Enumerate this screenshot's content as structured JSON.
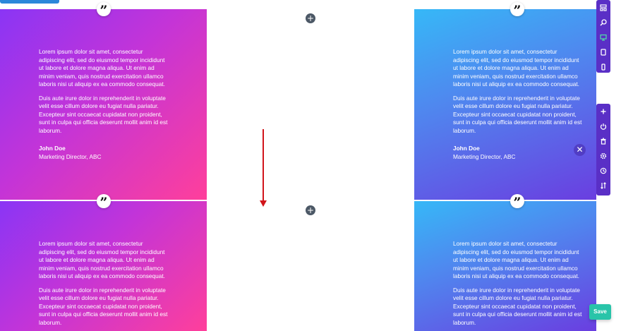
{
  "testimonial": {
    "paragraph1": "Lorem ipsum dolor sit amet, consectetur adipiscing elit, sed do eiusmod tempor incididunt ut labore et dolore magna aliqua. Ut enim ad minim veniam, quis nostrud exercitation ullamco laboris nisi ut aliquip ex ea commodo consequat.",
    "paragraph2": "Duis aute irure dolor in reprehenderit in voluptate velit esse cillum dolore eu fugiat nulla pariatur. Excepteur sint occaecat cupidatat non proident, sunt in culpa qui officia deserunt mollit anim id est laborum.",
    "author": "John Doe",
    "role": "Marketing Director, ABC"
  },
  "ui": {
    "quote_glyph": "”",
    "add_glyph": "+",
    "close_glyph": "✕",
    "save_label": "Save"
  },
  "colors": {
    "pink_gradient": [
      "#8a35f5",
      "#c334d8",
      "#ff3f9b"
    ],
    "blue_gradient": [
      "#36b8f7",
      "#4f88ef",
      "#6a3ee0"
    ],
    "arrow": "#d1141a",
    "save": "#29c4a9",
    "toolbar": "#5a2fc6"
  },
  "toolbar_top": [
    "wireframe-icon",
    "zoom-icon",
    "desktop-icon",
    "tablet-icon",
    "phone-icon"
  ],
  "toolbar_bottom": [
    "add-icon",
    "power-icon",
    "trash-icon",
    "settings-icon",
    "history-icon",
    "sort-icon"
  ]
}
